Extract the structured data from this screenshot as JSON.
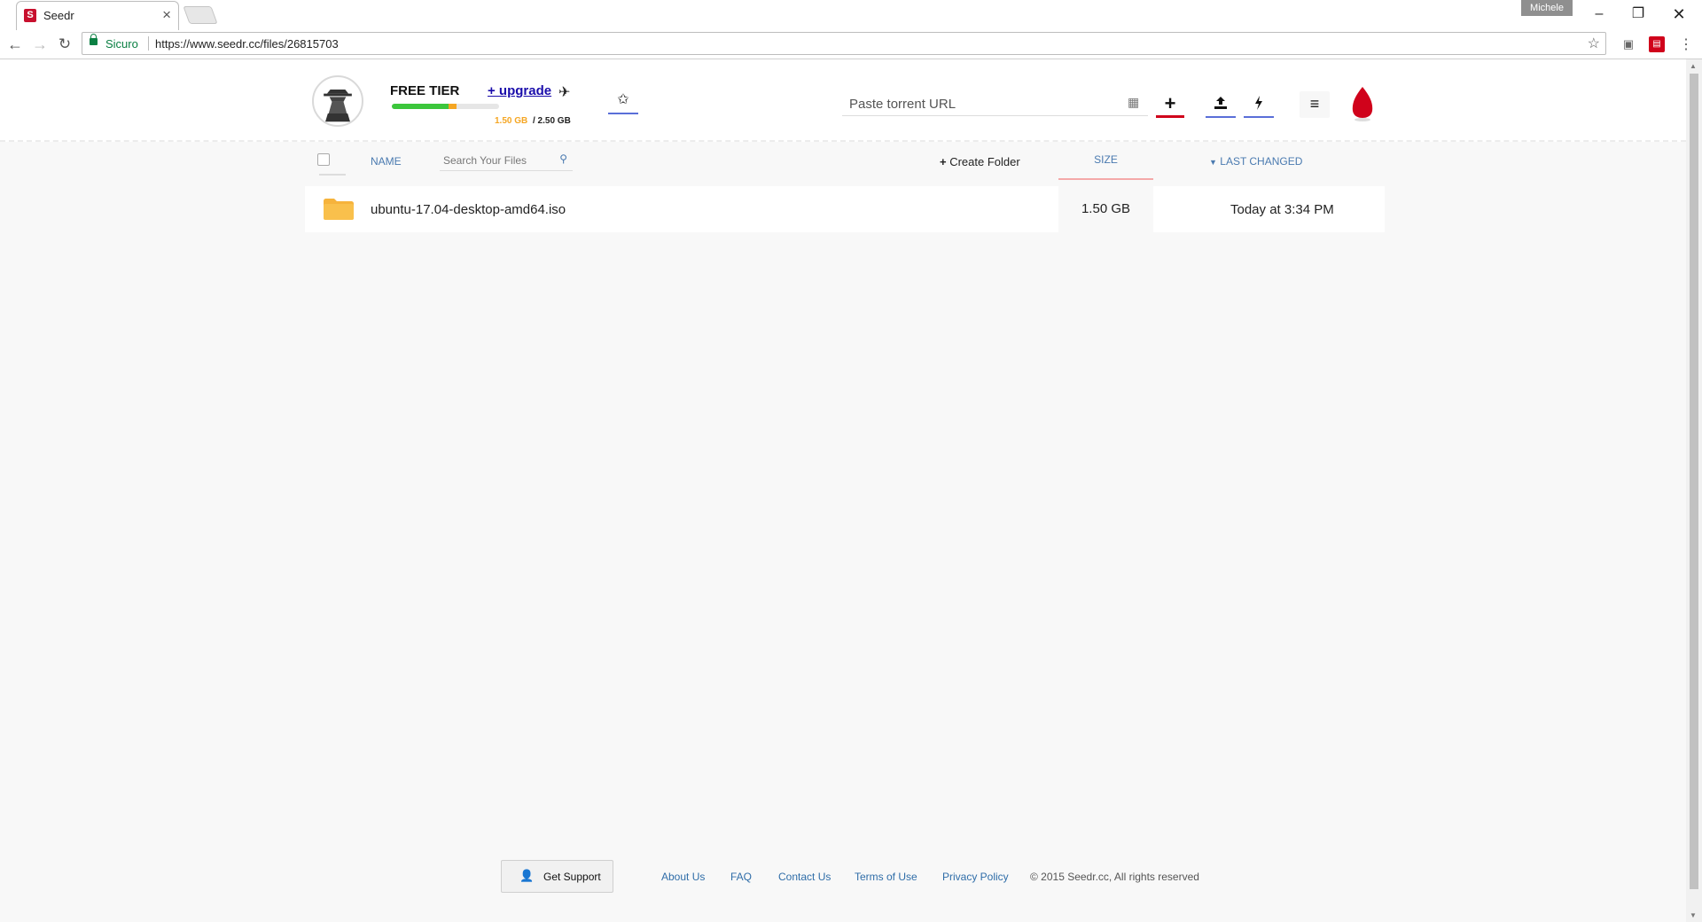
{
  "browser": {
    "tab_title": "Seedr",
    "tab_favicon": "S",
    "profile_name": "Michele",
    "secure_label": "Sicuro",
    "url": "https://www.seedr.cc/files/26815703"
  },
  "header": {
    "tier": "FREE TIER",
    "upgrade_label": "+ upgrade",
    "storage_used": "1.50 GB",
    "storage_total": "/ 2.50 GB",
    "storage_fraction": 0.6,
    "torrent_placeholder": "Paste torrent URL"
  },
  "icons": {
    "avatar": "spy-avatar-icon",
    "upgrade": "airplane-icon",
    "favorites": "star-icon",
    "magnet": "magnet-icon",
    "add": "plus-icon",
    "upload": "upload-icon",
    "flash": "lightning-icon",
    "menu": "hamburger-menu-icon",
    "logo": "seed-logo-icon"
  },
  "table": {
    "col_name": "NAME",
    "search_placeholder": "Search Your Files",
    "create_folder": "Create Folder",
    "col_size": "SIZE",
    "col_changed": "LAST CHANGED",
    "rows": [
      {
        "name": "ubuntu-17.04-desktop-amd64.iso",
        "size": "1.50 GB",
        "changed": "Today at 3:34 PM"
      }
    ]
  },
  "footer": {
    "support": "Get Support",
    "links": [
      "About Us",
      "FAQ",
      "Contact Us",
      "Terms of Use",
      "Privacy Policy"
    ],
    "copyright": "© 2015 Seedr.cc, All rights reserved"
  },
  "colors": {
    "brand_red": "#d0021b",
    "link_blue": "#4a7ab0",
    "progress_green": "#3cc63c",
    "progress_orange": "#f5a623",
    "folder_yellow": "#f6b33c"
  }
}
